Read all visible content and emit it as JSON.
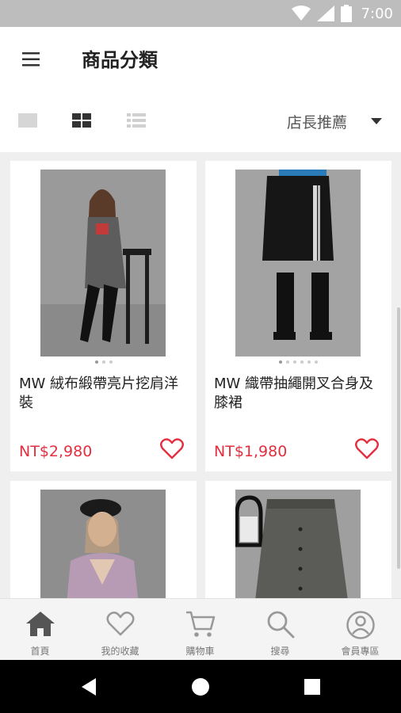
{
  "status": {
    "time": "7:00"
  },
  "header": {
    "title": "商品分類"
  },
  "toolbar": {
    "sort_label": "店長推薦"
  },
  "products": [
    {
      "name": "MW 絨布緞帶亮片挖肩洋裝",
      "price": "NT$2,980",
      "image": "woman-grey-sweater-dress-boots-on-stool"
    },
    {
      "name": "MW 織帶抽繩開叉合身及膝裙",
      "price": "NT$1,980",
      "image": "black-side-stripe-skirt-with-boots"
    },
    {
      "name": "",
      "price": "",
      "image": "woman-in-lilac-blouse-with-cap"
    },
    {
      "name": "",
      "price": "",
      "image": "grey-pleated-button-skirt-with-bag"
    }
  ],
  "nav": [
    {
      "label": "首頁",
      "icon": "home-icon"
    },
    {
      "label": "我的收藏",
      "icon": "heart-icon"
    },
    {
      "label": "購物車",
      "icon": "cart-icon"
    },
    {
      "label": "搜尋",
      "icon": "search-icon"
    },
    {
      "label": "會員專區",
      "icon": "user-icon"
    }
  ],
  "colors": {
    "price": "#e32f3f",
    "accent": "#e32f3f",
    "nav_active": "#555555",
    "nav_inactive": "#999999"
  }
}
